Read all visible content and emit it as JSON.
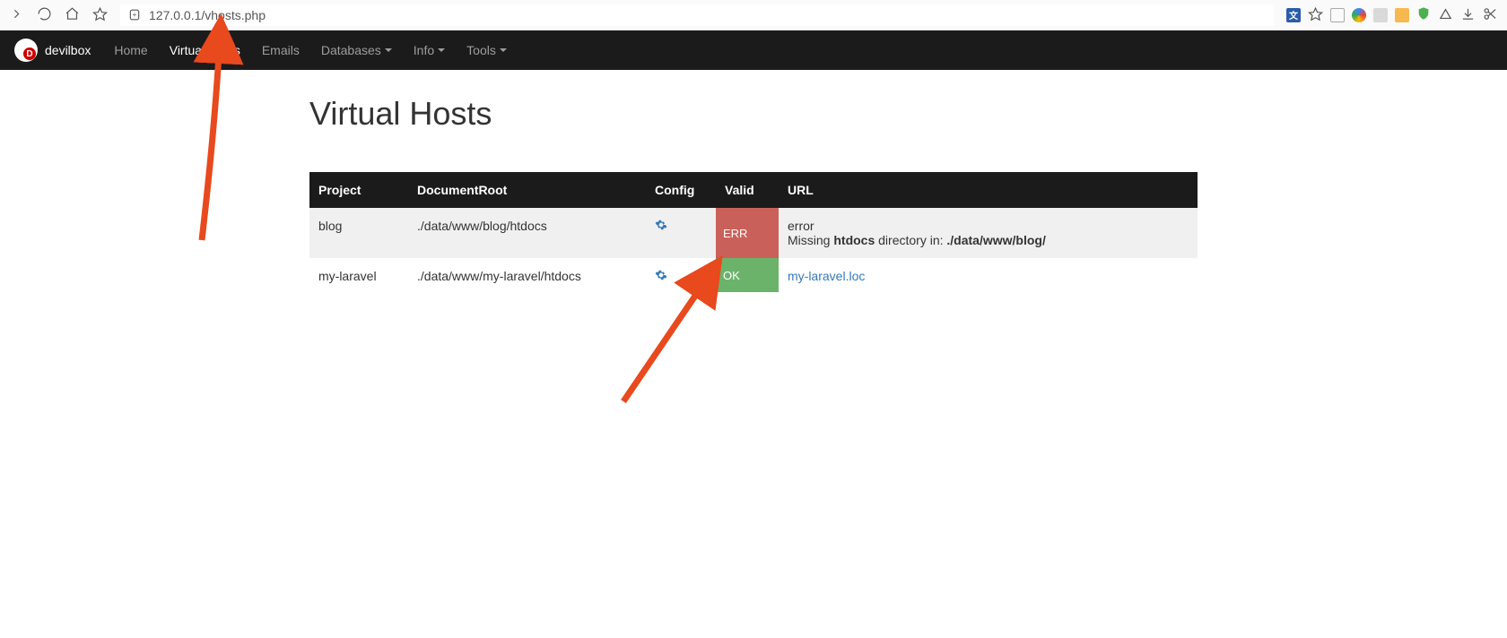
{
  "browser": {
    "url": "127.0.0.1/vhosts.php"
  },
  "navbar": {
    "brand": "devilbox",
    "items": [
      {
        "label": "Home",
        "active": false
      },
      {
        "label": "Virtual Hosts",
        "active": true
      },
      {
        "label": "Emails",
        "active": false
      },
      {
        "label": "Databases",
        "active": false,
        "caret": true
      },
      {
        "label": "Info",
        "active": false,
        "caret": true
      },
      {
        "label": "Tools",
        "active": false,
        "caret": true
      }
    ]
  },
  "page": {
    "title": "Virtual Hosts"
  },
  "table": {
    "headers": {
      "project": "Project",
      "docroot": "DocumentRoot",
      "config": "Config",
      "valid": "Valid",
      "url": "URL"
    },
    "rows": [
      {
        "project": "blog",
        "docroot": "./data/www/blog/htdocs",
        "valid_status": "ERR",
        "valid_kind": "err",
        "url_text": "error",
        "url_detail_prefix": "Missing ",
        "url_detail_bold1": "htdocs",
        "url_detail_mid": " directory in: ",
        "url_detail_bold2": "./data/www/blog/"
      },
      {
        "project": "my-laravel",
        "docroot": "./data/www/my-laravel/htdocs",
        "valid_status": "OK",
        "valid_kind": "ok",
        "url_link": "my-laravel.loc"
      }
    ]
  }
}
